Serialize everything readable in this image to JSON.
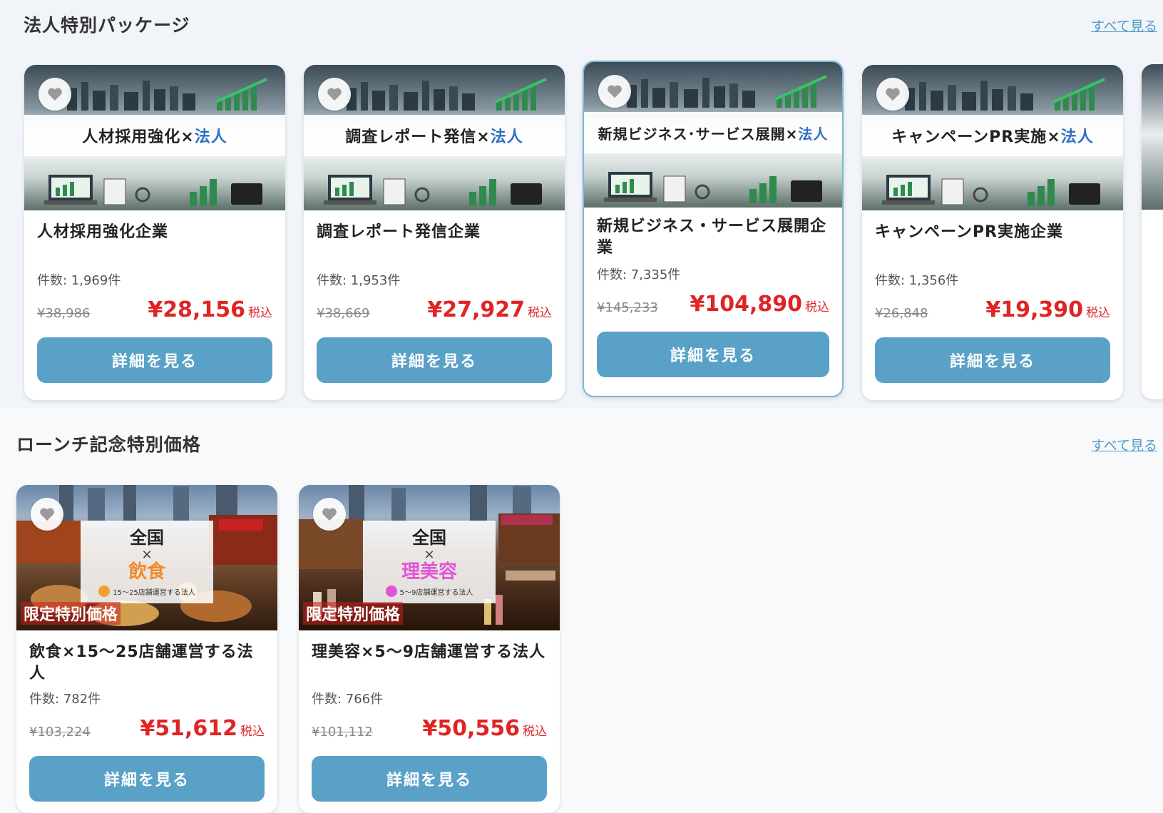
{
  "section1": {
    "title": "法人特別パッケージ",
    "see_all": "すべて見る",
    "cards": [
      {
        "banner_main": "人材採用強化×",
        "banner_hl": "法人",
        "title": "人材採用強化企業",
        "count": "件数: 1,969件",
        "old_price": "¥38,986",
        "new_price": "¥28,156",
        "tax": "税込",
        "button": "詳細を見る"
      },
      {
        "banner_main": "調査レポート発信×",
        "banner_hl": "法人",
        "title": "調査レポート発信企業",
        "count": "件数: 1,953件",
        "old_price": "¥38,669",
        "new_price": "¥27,927",
        "tax": "税込",
        "button": "詳細を見る"
      },
      {
        "banner_main": "新規ビジネス･サービス展開×",
        "banner_hl": "法人",
        "title": "新規ビジネス・サービス展開企業",
        "count": "件数: 7,335件",
        "old_price": "¥145,233",
        "new_price": "¥104,890",
        "tax": "税込",
        "button": "詳細を見る"
      },
      {
        "banner_main": "キャンペーンPR実施×",
        "banner_hl": "法人",
        "title": "キャンペーンPR実施企業",
        "count": "件数: 1,356件",
        "old_price": "¥26,848",
        "new_price": "¥19,390",
        "tax": "税込",
        "button": "詳細を見る"
      }
    ]
  },
  "section2": {
    "title": "ローンチ記念特別価格",
    "see_all": "すべて見る",
    "cards": [
      {
        "region": "全国",
        "times": "×",
        "category": "飲食",
        "category_color": "#f08a2a",
        "sub": "15〜25店舗運営する法人",
        "limited": "限定特別価格",
        "title": "飲食×15〜25店舗運営する法人",
        "count": "件数: 782件",
        "old_price": "¥103,224",
        "new_price": "¥51,612",
        "tax": "税込",
        "button": "詳細を見る"
      },
      {
        "region": "全国",
        "times": "×",
        "category": "理美容",
        "category_color": "#e055d8",
        "sub": "5〜9店舗運営する法人",
        "limited": "限定特別価格",
        "title": "理美容×5〜9店舗運営する法人",
        "count": "件数: 766件",
        "old_price": "¥101,112",
        "new_price": "¥50,556",
        "tax": "税込",
        "button": "詳細を見る"
      }
    ]
  },
  "icons": {
    "favorite": "heart-icon"
  }
}
